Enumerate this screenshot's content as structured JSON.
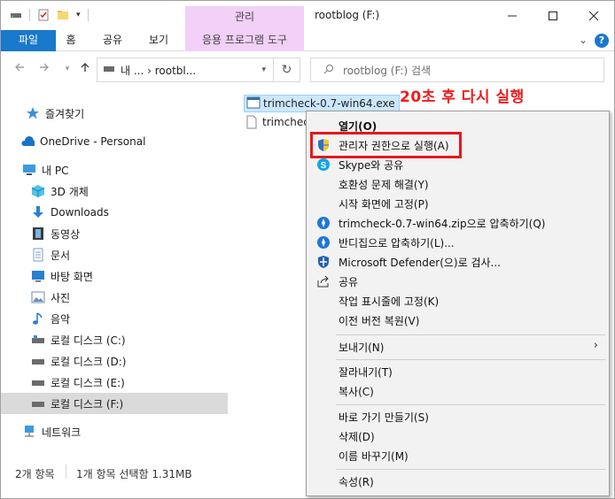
{
  "window": {
    "title": "rootblog (F:)",
    "manage_tab_top": "관리"
  },
  "ribbon": {
    "file": "파일",
    "home": "홈",
    "share": "공유",
    "view": "보기",
    "manage_tab": "응용 프로그램 도구"
  },
  "address": {
    "path": "내 ... › rootbl...",
    "search_placeholder": "rootblog (F:) 검색"
  },
  "nav": {
    "quick_access": "즐겨찾기",
    "onedrive": "OneDrive - Personal",
    "this_pc": "내 PC",
    "objects3d": "3D 개체",
    "downloads": "Downloads",
    "videos": "동영상",
    "documents": "문서",
    "desktop": "바탕 화면",
    "pictures": "사진",
    "music": "음악",
    "drive_c": "로컬 디스크 (C:)",
    "drive_d": "로컬 디스크 (D:)",
    "drive_e": "로컬 디스크 (E:)",
    "drive_f": "로컬 디스크 (F:)",
    "network": "네트워크"
  },
  "files": [
    {
      "name": "trimcheck-0.7-win64.exe"
    },
    {
      "name": "trimcheck"
    }
  ],
  "annotation": "20초 후 다시 실행",
  "status": {
    "count": "2개 항목",
    "selection": "1개 항목 선택함 1.31MB"
  },
  "menu": {
    "open": "열기(O)",
    "run_as_admin": "관리자 권한으로 실행(A)",
    "skype_share": "Skype와 공유",
    "compat": "호환성 문제 해결(Y)",
    "pin_start": "시작 화면에 고정(P)",
    "zip_to": "trimcheck-0.7-win64.zip으로 압축하기(Q)",
    "bandizip": "반디집으로 압축하기(L)...",
    "defender": "Microsoft Defender(으)로 검사...",
    "share": "공유",
    "pin_taskbar": "작업 표시줄에 고정(K)",
    "restore": "이전 버전 복원(V)",
    "send_to": "보내기(N)",
    "cut": "잘라내기(T)",
    "copy": "복사(C)",
    "shortcut": "바로 가기 만들기(S)",
    "delete": "삭제(D)",
    "rename": "이름 바꾸기(M)",
    "properties": "속성(R)"
  },
  "colors": {
    "file_tab": "#1979ca",
    "manage_tab": "#f2d0f7",
    "highlight": "#e8161c",
    "selection": "#cce8ff"
  }
}
